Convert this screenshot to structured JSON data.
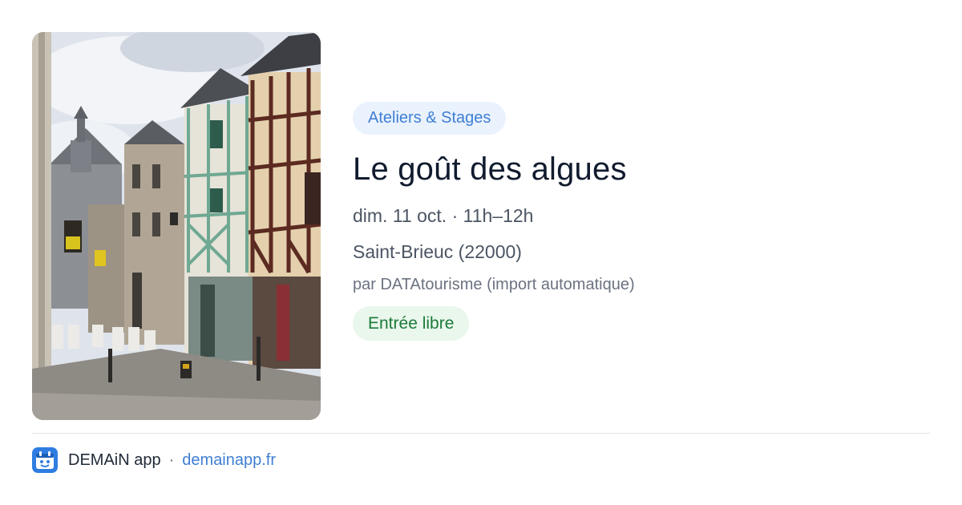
{
  "event": {
    "image_alt": "Rue pavée avec maisons à colombages",
    "category": "Ateliers & Stages",
    "title": "Le goût des algues",
    "datetime": "dim. 11 oct. · 11h–12h",
    "location": "Saint-Brieuc (22000)",
    "organizer": "par DATAtourisme (import automatique)",
    "price": "Entrée libre"
  },
  "footer": {
    "app_name": "DEMAiN app",
    "separator": "·",
    "domain": "demainapp.fr",
    "logo_icon": "demain-app-logo-icon"
  },
  "colors": {
    "accent": "#3f7fd3",
    "category_bg": "#eaf2fd",
    "price_bg": "#e9f7ec",
    "price_text": "#1d7a3a",
    "title": "#111b2e"
  }
}
